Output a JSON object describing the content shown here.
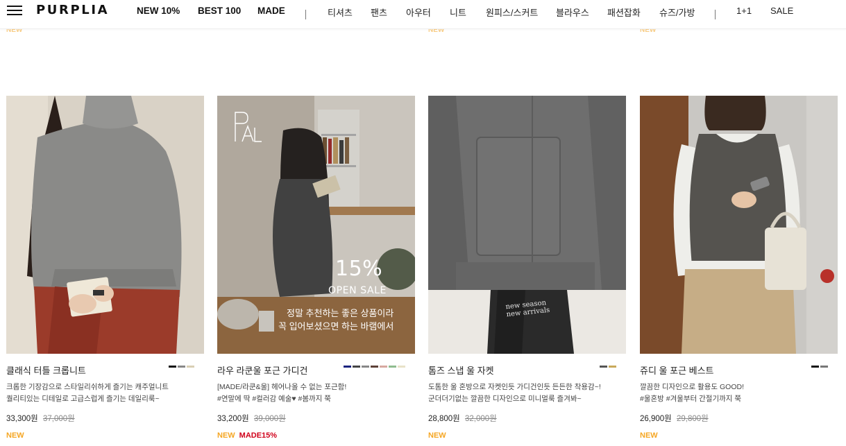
{
  "header": {
    "logo": "PURPLIA",
    "nav_bold": [
      "NEW 10%",
      "BEST 100",
      "MADE"
    ],
    "nav_categories": [
      "티셔츠",
      "팬츠",
      "아우터",
      "니트",
      "원피스/스커트",
      "블라우스",
      "패션잡화",
      "슈즈/가방"
    ],
    "nav_extra": [
      "1+1",
      "SALE"
    ]
  },
  "prev_row_badge": "NEW",
  "products": [
    {
      "name": "클래식 터틀 크롭니트",
      "swatches": [
        "#111111",
        "#888888",
        "#d9cfb4"
      ],
      "desc1": "크롭한 기장감으로 스타일리쉬하게 즐기는 캐주얼니트",
      "desc2": "퀄리티있는 디테일로 고급스럽게 즐기는 데일리룩~",
      "price": "33,300원",
      "original_price": "37,000원",
      "badge_new": "NEW",
      "badge_made": ""
    },
    {
      "name": "라우 라쿤울 포근 가디건",
      "swatches": [
        "#1a237e",
        "#444444",
        "#888888",
        "#5d4037",
        "#d7a8a0",
        "#8fbc8f",
        "#e8e2c8"
      ],
      "desc1": "[MADE/라쿤&울] 헤어나올 수 없는 포근함!",
      "desc2": "#연말에 딱 #컬러감 예술♥ #봄까지 쭉",
      "price": "33,200원",
      "original_price": "39,000원",
      "badge_new": "NEW",
      "badge_made": "MADE15%",
      "overlay": {
        "logo": "PAL",
        "sale_pct": "15%",
        "sale_text": "OPEN SALE",
        "line1": "정말 추천하는 좋은 상품이라",
        "line2": "꼭 입어보셨으면 하는 바램에서"
      }
    },
    {
      "name": "톰즈 스냅 울 자켓",
      "swatches": [
        "#555555",
        "#c8a95a"
      ],
      "desc1": "도톰한 울 혼방으로 자켓인듯 가디건인듯 든든한 착용감~!",
      "desc2": "군더더기없는 깔끔한 디자인으로 미니멀룩 즐겨봐~",
      "price": "28,800원",
      "original_price": "32,000원",
      "badge_new": "NEW",
      "badge_made": "",
      "overlay": {
        "line1": "new season",
        "line2": "new arrivals"
      }
    },
    {
      "name": "쥬디 울 포근 베스트",
      "swatches": [
        "#111111",
        "#777777"
      ],
      "desc1": "깔끔한 디자인으로 활용도 GOOD!",
      "desc2": "#울혼방 #겨울부터 간절기까지 쭉",
      "price": "26,900원",
      "original_price": "29,800원",
      "badge_new": "NEW",
      "badge_made": ""
    }
  ]
}
